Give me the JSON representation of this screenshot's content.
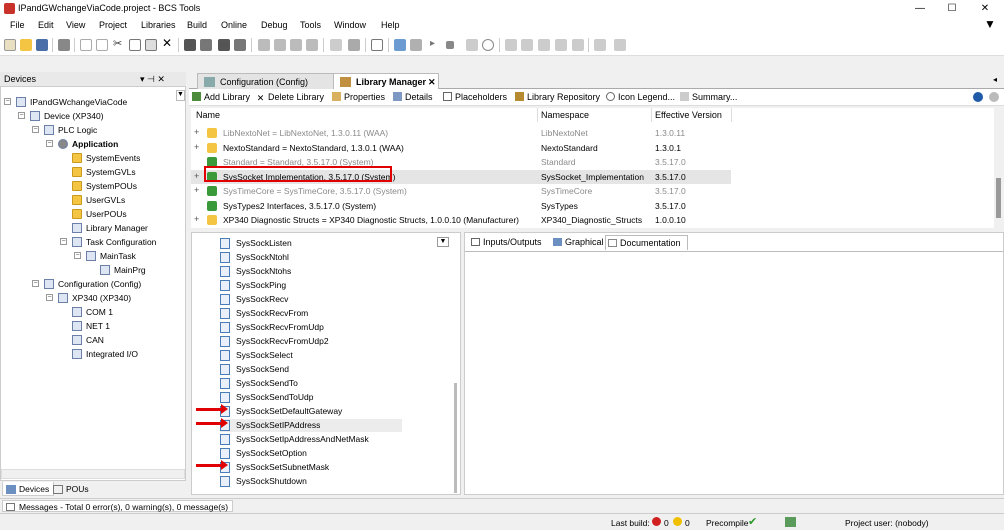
{
  "window": {
    "title": "IPandGWchangeViaCode.project - BCS Tools",
    "min": "—",
    "max": "☐",
    "close": "✕"
  },
  "menu": [
    "File",
    "Edit",
    "View",
    "Project",
    "Libraries",
    "Build",
    "Online",
    "Debug",
    "Tools",
    "Window",
    "Help"
  ],
  "devices_panel": {
    "title": "Devices",
    "pin": "▾ ⊣ ✕",
    "tree": [
      {
        "label": "IPandGWchangeViaCode",
        "level": 0,
        "icon": "project-icon"
      },
      {
        "label": "Device (XP340)",
        "level": 1,
        "icon": "device-icon"
      },
      {
        "label": "PLC Logic",
        "level": 2,
        "icon": "plc-logic-icon"
      },
      {
        "label": "Application",
        "level": 3,
        "icon": "application-icon",
        "bold": true
      },
      {
        "label": "SystemEvents",
        "level": 4,
        "icon": "folder-icon"
      },
      {
        "label": "SystemGVLs",
        "level": 4,
        "icon": "folder-icon"
      },
      {
        "label": "SystemPOUs",
        "level": 4,
        "icon": "folder-icon"
      },
      {
        "label": "UserGVLs",
        "level": 4,
        "icon": "folder-icon"
      },
      {
        "label": "UserPOUs",
        "level": 4,
        "icon": "folder-icon"
      },
      {
        "label": "Library Manager",
        "level": 4,
        "icon": "library-icon"
      },
      {
        "label": "Task Configuration",
        "level": 4,
        "icon": "task-config-icon"
      },
      {
        "label": "MainTask",
        "level": 5,
        "icon": "task-icon"
      },
      {
        "label": "MainPrg",
        "level": 6,
        "icon": "program-icon"
      },
      {
        "label": "Configuration (Config)",
        "level": 2,
        "icon": "config-icon"
      },
      {
        "label": "XP340 (XP340)",
        "level": 3,
        "icon": "module-icon"
      },
      {
        "label": "COM 1",
        "level": 4,
        "icon": "port-icon"
      },
      {
        "label": "NET 1",
        "level": 4,
        "icon": "port-icon"
      },
      {
        "label": "CAN",
        "level": 4,
        "icon": "port-icon"
      },
      {
        "label": "Integrated I/O",
        "level": 4,
        "icon": "port-icon"
      }
    ],
    "bottom_tabs": [
      "Devices",
      "POUs"
    ]
  },
  "editor_tabs": [
    {
      "label": "Configuration (Config)",
      "active": false
    },
    {
      "label": "Library Manager",
      "active": true,
      "close": "✕"
    }
  ],
  "lib_toolbar": [
    "Add Library",
    "Delete Library",
    "Properties",
    "Details",
    "Placeholders",
    "Library Repository",
    "Icon Legend...",
    "Summary..."
  ],
  "lib_grid": {
    "headers": [
      "Name",
      "Namespace",
      "Effective Version"
    ],
    "rows": [
      {
        "name": "LibNextoNet = LibNextoNet, 1.3.0.11 (WAA)",
        "ns": "LibNextoNet",
        "ver": "1.3.0.11",
        "gray": true,
        "icon": "folder",
        "exp": true
      },
      {
        "name": "NextoStandard = NextoStandard, 1.3.0.1 (WAA)",
        "ns": "NextoStandard",
        "ver": "1.3.0.1",
        "gray": false,
        "icon": "folder",
        "exp": true
      },
      {
        "name": "Standard = Standard, 3.5.17.0 (System)",
        "ns": "Standard",
        "ver": "3.5.17.0",
        "gray": true,
        "icon": "green",
        "exp": false
      },
      {
        "name": "SysSocket Implementation, 3.5.17.0 (System)",
        "ns": "SysSocket_Implementation",
        "ver": "3.5.17.0",
        "gray": false,
        "icon": "green",
        "exp": true,
        "selected": true
      },
      {
        "name": "SysTimeCore = SysTimeCore, 3.5.17.0 (System)",
        "ns": "SysTimeCore",
        "ver": "3.5.17.0",
        "gray": true,
        "icon": "green",
        "exp": true
      },
      {
        "name": "SysTypes2 Interfaces, 3.5.17.0 (System)",
        "ns": "SysTypes",
        "ver": "3.5.17.0",
        "gray": false,
        "icon": "green",
        "exp": false
      },
      {
        "name": "XP340 Diagnostic Structs = XP340 Diagnostic Structs, 1.0.0.10 (Manufacturer)",
        "ns": "XP340_Diagnostic_Structs",
        "ver": "1.0.0.10",
        "gray": false,
        "icon": "folder",
        "exp": true
      }
    ]
  },
  "pous": [
    "SysSockListen",
    "SysSockNtohl",
    "SysSockNtohs",
    "SysSockPing",
    "SysSockRecv",
    "SysSockRecvFrom",
    "SysSockRecvFromUdp",
    "SysSockRecvFromUdp2",
    "SysSockSelect",
    "SysSockSend",
    "SysSockSendTo",
    "SysSockSendToUdp",
    "SysSockSetDefaultGateway",
    "SysSockSetIPAddress",
    "SysSockSetIpAddressAndNetMask",
    "SysSockSetOption",
    "SysSockSetSubnetMask",
    "SysSockShutdown"
  ],
  "doc_tabs": [
    "Inputs/Outputs",
    "Graphical",
    "Documentation"
  ],
  "status": {
    "messages": "Messages - Total 0 error(s), 0 warning(s), 0 message(s)",
    "last_build": "Last build:",
    "errors": "0",
    "warnings": "0",
    "precompile": "Precompile",
    "project_user": "Project user: (nobody)"
  },
  "colors": {
    "red_annotation": "#e00000",
    "selection": "#e5e5e5",
    "folder": "#f4c542",
    "green_lib": "#3a9a3a"
  }
}
